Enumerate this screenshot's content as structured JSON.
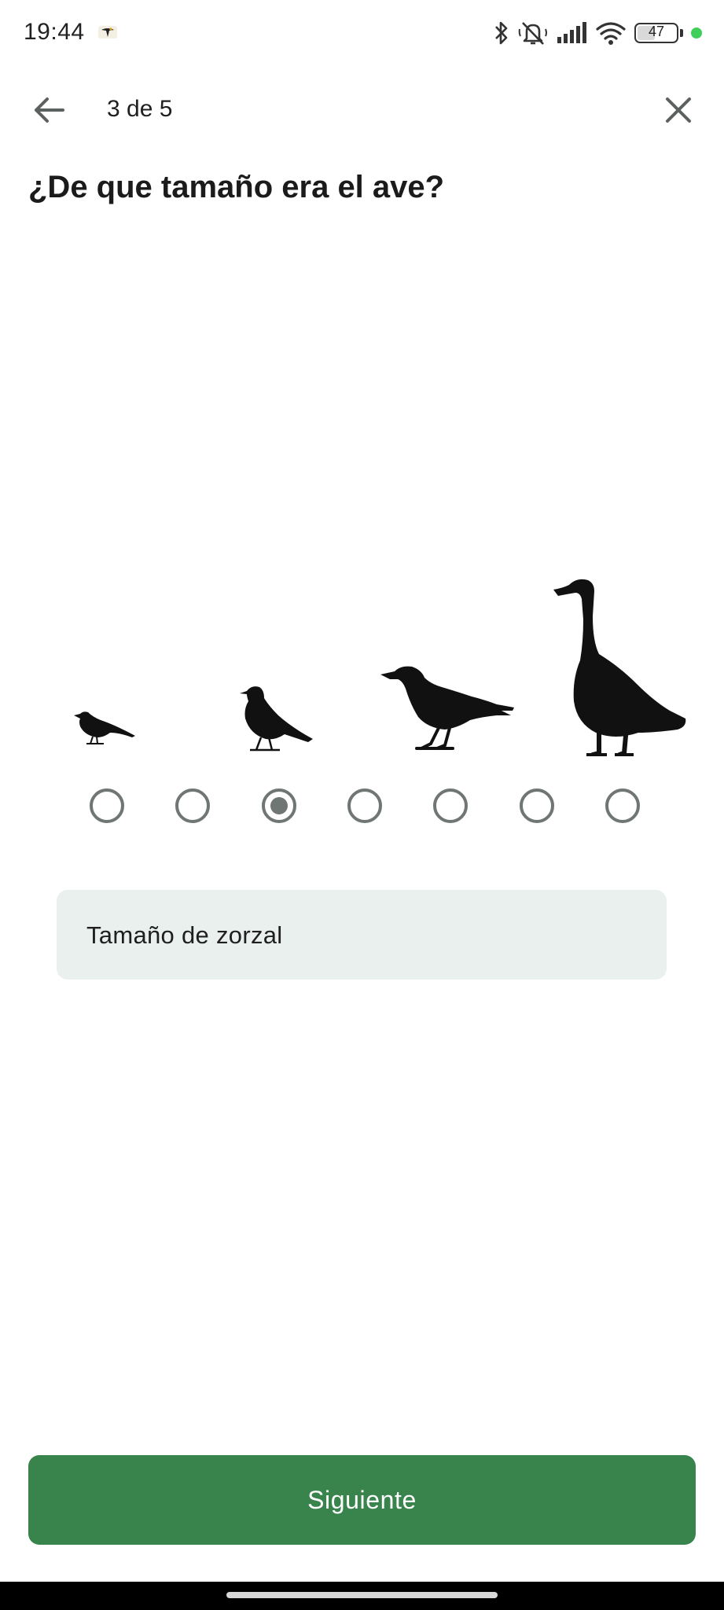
{
  "status_bar": {
    "time": "19:44",
    "notification_icon": "bird-app-icon",
    "icons": [
      "bluetooth-icon",
      "mute-icon",
      "signal-icon",
      "wifi-icon"
    ],
    "battery_level": "47",
    "dot_color": "#3ecf5a"
  },
  "header": {
    "back_icon": "arrow-back-icon",
    "step": "3 de 5",
    "close_icon": "close-icon"
  },
  "question": "¿De que tamaño era el ave?",
  "size_scale": {
    "bird_icons": [
      "sparrow-silhouette",
      "thrush-silhouette",
      "crow-silhouette",
      "goose-silhouette"
    ],
    "option_count": 7,
    "selected_index": 2
  },
  "selected_size_label": "Tamaño de zorzal",
  "buttons": {
    "next": "Siguiente"
  },
  "colors": {
    "primary": "#38844c",
    "radio": "#6f7673",
    "info_box": "#eaf0ee"
  }
}
